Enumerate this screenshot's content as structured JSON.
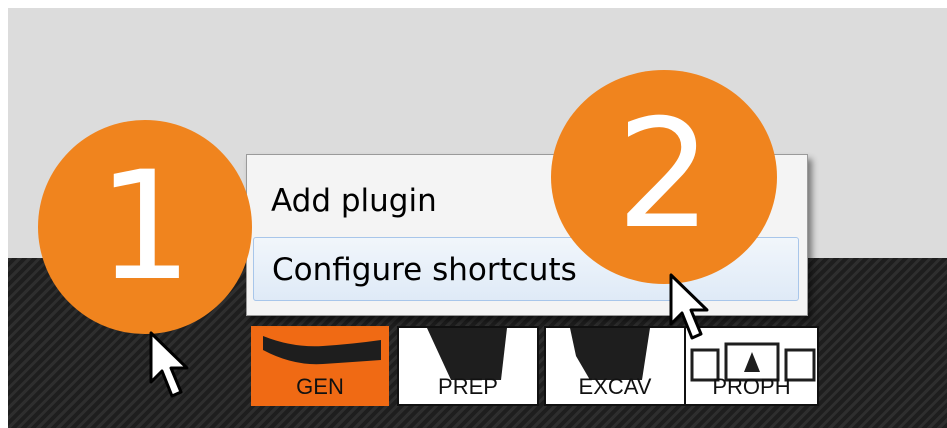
{
  "context_menu": {
    "items": [
      {
        "label": "Add plugin"
      },
      {
        "label": "Configure shortcuts"
      }
    ],
    "highlighted_index": 1
  },
  "toolbar": {
    "buttons": [
      {
        "label": "GEN",
        "active": true
      },
      {
        "label": "PREP",
        "active": false
      },
      {
        "label": "EXCAV",
        "active": false
      },
      {
        "label": "PROPH",
        "active": false
      }
    ]
  },
  "callouts": [
    {
      "number": "1"
    },
    {
      "number": "2"
    }
  ],
  "colors": {
    "callout": "#f0841e",
    "active_button": "#f06a14",
    "menu_highlight_border": "#a8c6ea",
    "top_background": "#dcdcdc",
    "toolbar_background": "#262626"
  }
}
